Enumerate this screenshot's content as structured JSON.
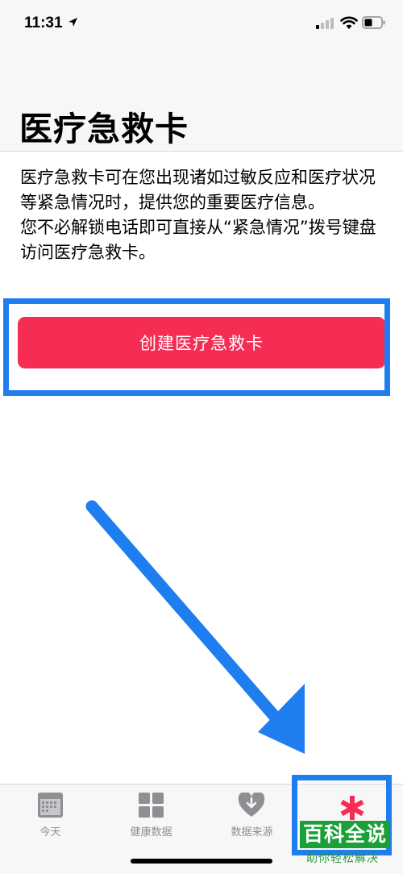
{
  "status_bar": {
    "time": "11:31"
  },
  "header": {
    "title": "医疗急救卡"
  },
  "description": {
    "paragraph1": "医疗急救卡可在您出现诸如过敏反应和医疗状况等紧急情况时，提供您的重要医疗信息。",
    "paragraph2": "您不必解锁电话即可直接从“紧急情况”拨号键盘访问医疗急救卡。"
  },
  "primary_button": {
    "label": "创建医疗急救卡"
  },
  "tab_bar": {
    "tabs": [
      {
        "label": "今天",
        "icon": "calendar-icon"
      },
      {
        "label": "健康数据",
        "icon": "grid-icon"
      },
      {
        "label": "数据来源",
        "icon": "heart-download-icon"
      },
      {
        "label": "",
        "icon": "medical-id-asterisk-icon"
      }
    ]
  },
  "watermark": {
    "title": "百科全说",
    "subtitle": "助你轻松解决"
  },
  "colors": {
    "accent_red": "#f52d55",
    "annotation_blue": "#1e7ef0",
    "watermark_green": "#1ba037"
  }
}
